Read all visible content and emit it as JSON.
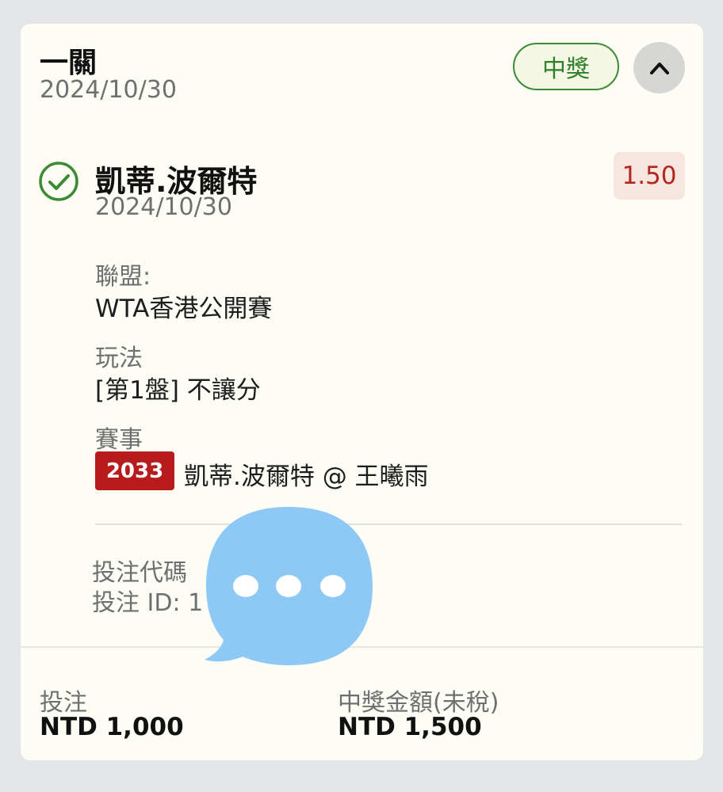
{
  "header": {
    "title": "一關",
    "date": "2024/10/30",
    "status_badge": "中獎",
    "collapse_icon": "chevron-up-icon"
  },
  "selection": {
    "status_icon": "check-circle-icon",
    "name": "凱蒂.波爾特",
    "date": "2024/10/30",
    "odds": "1.50"
  },
  "details": {
    "league_label": "聯盟:",
    "league_value": "WTA香港公開賽",
    "market_label": "玩法",
    "market_value": "[第1盤] 不讓分",
    "event_label": "賽事",
    "event_code": "2033",
    "event_value": "凱蒂.波爾特 @ 王曦雨"
  },
  "bet_info": {
    "code_line": "投注代碼",
    "id_line": "投注 ID: 1"
  },
  "footer": {
    "stake_label": "投注",
    "stake_value": "NTD 1,000",
    "payout_label": "中獎金額(未稅)",
    "payout_value": "NTD 1,500"
  },
  "colors": {
    "win_green": "#3c8a34",
    "odds_red": "#b3261e",
    "event_badge_red": "#b81b1b",
    "chat_bubble_blue": "#8ec9f5"
  },
  "overlay": {
    "icon": "chat-bubble-ellipsis-icon"
  }
}
